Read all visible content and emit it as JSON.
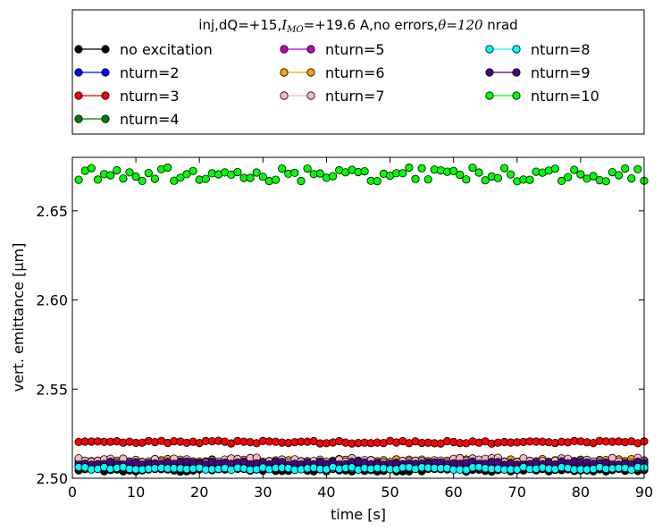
{
  "chart_data": {
    "type": "scatter",
    "title": "inj,dQ=+15,I_MO=+19.6 A,no errors,θ=120 nrad",
    "title_parts": {
      "prefix": "inj,dQ=+15,",
      "i_main": "I",
      "i_sub": "MO",
      "i_value": "=+19.6 A,no errors,",
      "theta": "θ=120",
      "suffix": " nrad"
    },
    "xlabel": "time [s]",
    "ylabel": "vert. emittance [μm]",
    "xlim": [
      0,
      90
    ],
    "ylim": [
      2.5,
      2.68
    ],
    "xticks": [
      0,
      10,
      20,
      30,
      40,
      50,
      60,
      70,
      80,
      90
    ],
    "xtick_labels": [
      "0",
      "10",
      "20",
      "30",
      "40",
      "50",
      "60",
      "70",
      "80",
      "90"
    ],
    "yticks": [
      2.5,
      2.55,
      2.6,
      2.65
    ],
    "ytick_labels": [
      "2.50",
      "2.55",
      "2.60",
      "2.65"
    ],
    "grid": false,
    "legend_position": "above plot, 3 columns",
    "x_start": 1,
    "x_step": 1,
    "series": [
      {
        "name": "no excitation",
        "color": "#000000",
        "base": 2.5045,
        "amp": 0.0008,
        "seed": 1
      },
      {
        "name": "nturn=2",
        "color": "#0000ff",
        "base": 2.5075,
        "amp": 0.001,
        "seed": 2
      },
      {
        "name": "nturn=3",
        "color": "#ff0000",
        "base": 2.5202,
        "amp": 0.0008,
        "seed": 3
      },
      {
        "name": "nturn=4",
        "color": "#008000",
        "base": 2.506,
        "amp": 0.0008,
        "seed": 4
      },
      {
        "name": "nturn=5",
        "color": "#bf00bf",
        "base": 2.5085,
        "amp": 0.001,
        "seed": 5
      },
      {
        "name": "nturn=6",
        "color": "#ffa500",
        "base": 2.5098,
        "amp": 0.001,
        "seed": 6
      },
      {
        "name": "nturn=7",
        "color": "#ffb6c1",
        "base": 2.51,
        "amp": 0.0015,
        "seed": 7
      },
      {
        "name": "nturn=8",
        "color": "#00ffff",
        "base": 2.5055,
        "amp": 0.0008,
        "seed": 8
      },
      {
        "name": "nturn=9",
        "color": "#4b0082",
        "base": 2.5085,
        "amp": 0.001,
        "seed": 9
      },
      {
        "name": "nturn=10",
        "color": "#00ff00",
        "base": 2.6705,
        "amp": 0.004,
        "seed": 10
      }
    ]
  }
}
